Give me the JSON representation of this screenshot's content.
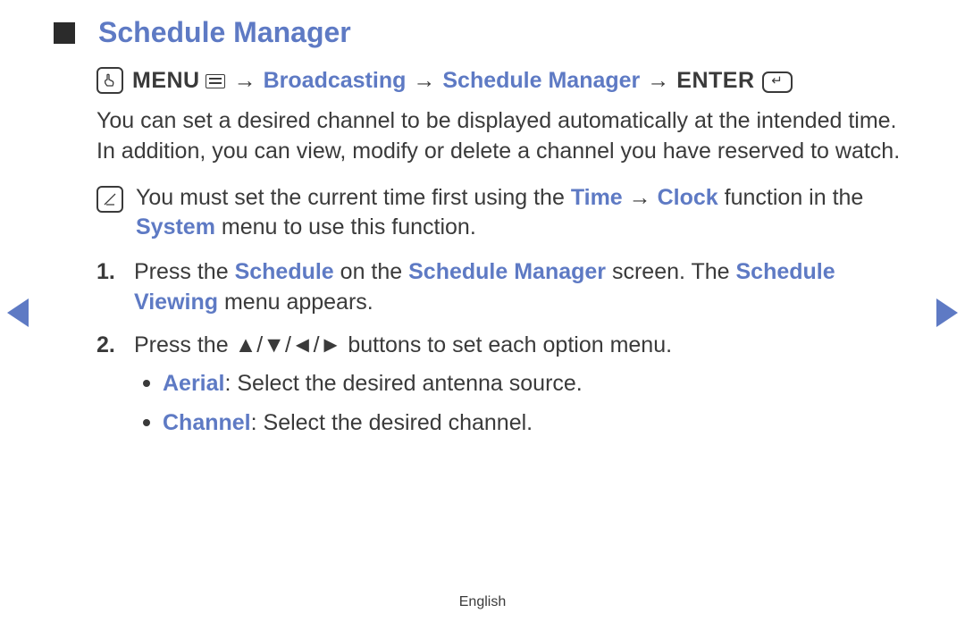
{
  "title": "Schedule Manager",
  "path": {
    "menu": "MENU",
    "arrow": "→",
    "broadcasting": "Broadcasting",
    "schedule_manager": "Schedule Manager",
    "enter": "ENTER"
  },
  "intro": "You can set a desired channel to be displayed automatically at the intended time. In addition, you can view, modify or delete a channel you have reserved to watch.",
  "note": {
    "pre": "You must set the current time first using the ",
    "time": "Time",
    "arrow": " → ",
    "clock": "Clock",
    "mid": " function in the ",
    "system": "System",
    "post": " menu to use this function."
  },
  "steps": {
    "s1": {
      "num": "1.",
      "pre": "Press the ",
      "schedule": "Schedule",
      "mid1": " on the ",
      "schedule_manager": "Schedule Manager",
      "mid2": " screen. The ",
      "schedule_viewing": "Schedule Viewing",
      "post": " menu appears."
    },
    "s2": {
      "num": "2.",
      "pre": "Press the ",
      "buttons": "▲/▼/◄/►",
      "post": " buttons to set each option menu.",
      "bullets": {
        "aerial_label": "Aerial",
        "aerial_text": ": Select the desired antenna source.",
        "channel_label": "Channel",
        "channel_text": ": Select the desired channel."
      }
    }
  },
  "footer": "English"
}
